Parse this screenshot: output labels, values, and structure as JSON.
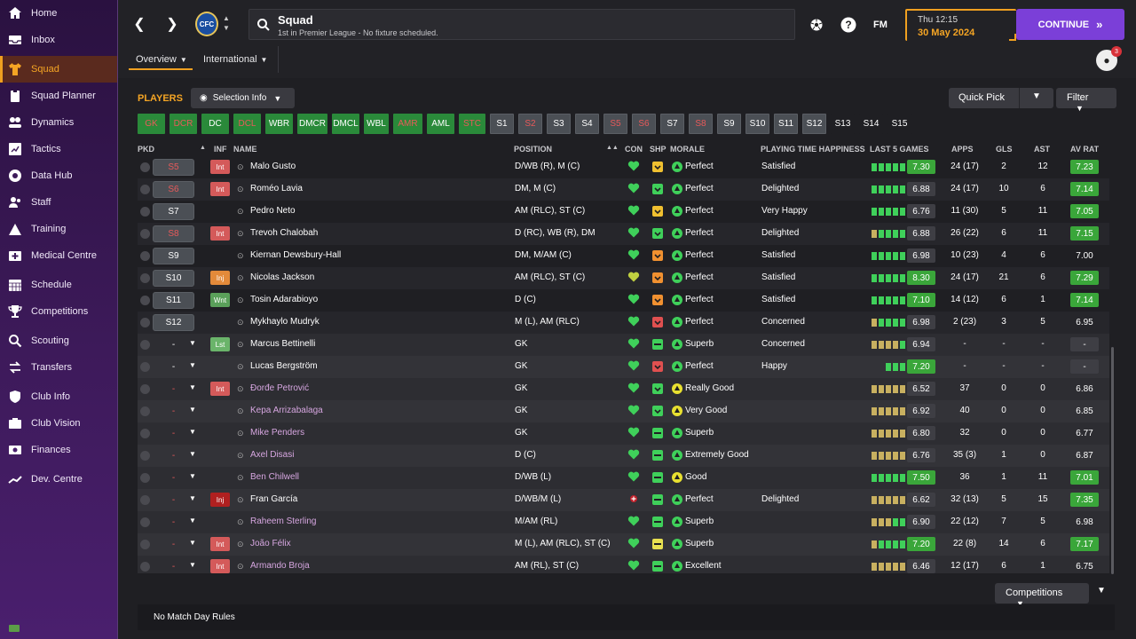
{
  "sidebar": {
    "items": [
      {
        "label": "Home",
        "icon": "home-icon"
      },
      {
        "label": "Inbox",
        "icon": "inbox-icon"
      },
      {
        "label": "Squad",
        "icon": "shirt-icon",
        "active": true
      },
      {
        "label": "Squad Planner",
        "icon": "clipboard-icon"
      },
      {
        "label": "Dynamics",
        "icon": "dynamics-icon"
      },
      {
        "label": "Tactics",
        "icon": "tactics-icon"
      },
      {
        "label": "Data Hub",
        "icon": "datahub-icon"
      },
      {
        "label": "Staff",
        "icon": "staff-icon"
      },
      {
        "label": "Training",
        "icon": "training-icon"
      },
      {
        "label": "Medical Centre",
        "icon": "medical-icon"
      },
      {
        "label": "Schedule",
        "icon": "calendar-icon"
      },
      {
        "label": "Competitions",
        "icon": "trophy-icon"
      },
      {
        "label": "Scouting",
        "icon": "search-icon"
      },
      {
        "label": "Transfers",
        "icon": "transfers-icon"
      },
      {
        "label": "Club Info",
        "icon": "shield-icon"
      },
      {
        "label": "Club Vision",
        "icon": "vision-icon"
      },
      {
        "label": "Finances",
        "icon": "finances-icon"
      },
      {
        "label": "Dev. Centre",
        "icon": "dev-centre-icon"
      }
    ]
  },
  "header": {
    "title": "Squad",
    "subtitle": "1st in Premier League - No fixture scheduled.",
    "fm_label": "FM",
    "date_day": "Thu 12:15",
    "date_date": "30 May 2024",
    "continue_label": "CONTINUE",
    "continue_icon": "»",
    "social_count": "3"
  },
  "tabs": {
    "overview": "Overview",
    "international": "International"
  },
  "panel": {
    "players_label": "PLAYERS",
    "selection_info": "Selection Info",
    "quick_pick": "Quick Pick",
    "filter": "Filter",
    "competitions": "Competitions",
    "match_day_rules": "No Match Day Rules"
  },
  "positions": [
    {
      "label": "GK",
      "style": "green-red",
      "w": 31
    },
    {
      "label": "DCR",
      "style": "green-red",
      "w": 31
    },
    {
      "label": "DC",
      "style": "green",
      "w": 31
    },
    {
      "label": "DCL",
      "style": "green-red",
      "w": 31
    },
    {
      "label": "WBR",
      "style": "green",
      "w": 31
    },
    {
      "label": "DMCR",
      "style": "green",
      "w": 34
    },
    {
      "label": "DMCL",
      "style": "green",
      "w": 31
    },
    {
      "label": "WBL",
      "style": "green",
      "w": 28
    },
    {
      "label": "AMR",
      "style": "green-red",
      "w": 33
    },
    {
      "label": "AML",
      "style": "green",
      "w": 31
    },
    {
      "label": "STC",
      "style": "green-red",
      "w": 30
    },
    {
      "label": "S1",
      "style": "grey",
      "w": 27
    },
    {
      "label": "S2",
      "style": "grey-red",
      "w": 27
    },
    {
      "label": "S3",
      "style": "grey",
      "w": 27
    },
    {
      "label": "S4",
      "style": "grey",
      "w": 27
    },
    {
      "label": "S5",
      "style": "grey-red",
      "w": 27
    },
    {
      "label": "S6",
      "style": "grey-red",
      "w": 27
    },
    {
      "label": "S7",
      "style": "grey",
      "w": 27
    },
    {
      "label": "S8",
      "style": "grey-red",
      "w": 27
    },
    {
      "label": "S9",
      "style": "grey",
      "w": 27
    },
    {
      "label": "S10",
      "style": "grey",
      "w": 27
    },
    {
      "label": "S11",
      "style": "grey",
      "w": 27
    },
    {
      "label": "S12",
      "style": "grey",
      "w": 27
    },
    {
      "label": "S13",
      "style": "dark",
      "w": 27
    },
    {
      "label": "S14",
      "style": "dark",
      "w": 27
    },
    {
      "label": "S15",
      "style": "dark",
      "w": 27
    }
  ],
  "columns": {
    "pkd": "PKD",
    "inf": "INF",
    "name": "NAME",
    "position": "POSITION",
    "con": "CON",
    "shp": "SHP",
    "morale": "MORALE",
    "pth": "PLAYING TIME HAPPINESS",
    "last5": "LAST 5 GAMES",
    "apps": "APPS",
    "gls": "GLS",
    "ast": "AST",
    "avrat": "AV RAT"
  },
  "colors": {
    "accent": "#f5a524",
    "continue": "#7b3fd8",
    "green": "#3aa63a",
    "red": "#d45a5a"
  },
  "players": [
    {
      "pkd": "S5",
      "pkd_style": "sq red",
      "inf": "Int",
      "name": "Malo Gusto",
      "pos": "D/WB (R), M (C)",
      "con": "full",
      "shp": "yellow",
      "mor_ico": "green",
      "morale": "Perfect",
      "pth": "Satisfied",
      "bars": [
        "g",
        "g",
        "g",
        "g",
        "g"
      ],
      "l5": "7.30",
      "l5_style": "rating-green",
      "apps": "24 (17)",
      "gls": "2",
      "ast": "12",
      "avr": "7.23",
      "avr_style": "rating-green",
      "lower": false
    },
    {
      "pkd": "S6",
      "pkd_style": "sq red",
      "inf": "Int",
      "name": "Roméo Lavia",
      "pos": "DM, M (C)",
      "con": "full",
      "shp": "green",
      "mor_ico": "green",
      "morale": "Perfect",
      "pth": "Delighted",
      "bars": [
        "g",
        "g",
        "g",
        "g",
        "g"
      ],
      "l5": "6.88",
      "l5_style": "rating-grey",
      "apps": "24 (17)",
      "gls": "10",
      "ast": "6",
      "avr": "7.14",
      "avr_style": "rating-green",
      "lower": false
    },
    {
      "pkd": "S7",
      "pkd_style": "sq",
      "inf": "",
      "name": "Pedro Neto",
      "pos": "AM (RLC), ST (C)",
      "con": "full",
      "shp": "yellow",
      "mor_ico": "green",
      "morale": "Perfect",
      "pth": "Very Happy",
      "bars": [
        "g",
        "g",
        "g",
        "g",
        "g"
      ],
      "l5": "6.76",
      "l5_style": "rating-grey",
      "apps": "11 (30)",
      "gls": "5",
      "ast": "11",
      "avr": "7.05",
      "avr_style": "rating-green",
      "lower": false
    },
    {
      "pkd": "S8",
      "pkd_style": "sq red",
      "inf": "Int",
      "name": "Trevoh Chalobah",
      "pos": "D (RC), WB (R), DM",
      "con": "full",
      "shp": "green",
      "mor_ico": "green",
      "morale": "Perfect",
      "pth": "Delighted",
      "bars": [
        "o",
        "g",
        "g",
        "g",
        "g"
      ],
      "l5": "6.88",
      "l5_style": "rating-grey",
      "apps": "26 (22)",
      "gls": "6",
      "ast": "11",
      "avr": "7.15",
      "avr_style": "rating-green",
      "lower": false
    },
    {
      "pkd": "S9",
      "pkd_style": "sq",
      "inf": "",
      "name": "Kiernan Dewsbury-Hall",
      "pos": "DM, M/AM (C)",
      "con": "full",
      "shp": "orange",
      "mor_ico": "green",
      "morale": "Perfect",
      "pth": "Satisfied",
      "bars": [
        "g",
        "g",
        "g",
        "g",
        "g"
      ],
      "l5": "6.98",
      "l5_style": "rating-grey",
      "apps": "10 (23)",
      "gls": "4",
      "ast": "6",
      "avr": "7.00",
      "avr_style": "rating-plain",
      "lower": false
    },
    {
      "pkd": "S10",
      "pkd_style": "sq",
      "inf": "Inj",
      "name": "Nicolas Jackson",
      "pos": "AM (RLC), ST (C)",
      "con": "half",
      "shp": "orange",
      "mor_ico": "green",
      "morale": "Perfect",
      "pth": "Satisfied",
      "bars": [
        "g",
        "g",
        "g",
        "g",
        "g"
      ],
      "l5": "8.30",
      "l5_style": "rating-green",
      "apps": "24 (17)",
      "gls": "21",
      "ast": "6",
      "avr": "7.29",
      "avr_style": "rating-green",
      "lower": false
    },
    {
      "pkd": "S11",
      "pkd_style": "sq",
      "inf": "Wnt",
      "name": "Tosin Adarabioyo",
      "pos": "D (C)",
      "con": "full",
      "shp": "orange",
      "mor_ico": "green",
      "morale": "Perfect",
      "pth": "Satisfied",
      "bars": [
        "g",
        "g",
        "g",
        "g",
        "g"
      ],
      "l5": "7.10",
      "l5_style": "rating-green",
      "apps": "14 (12)",
      "gls": "6",
      "ast": "1",
      "avr": "7.14",
      "avr_style": "rating-green",
      "lower": false
    },
    {
      "pkd": "S12",
      "pkd_style": "sq",
      "inf": "",
      "name": "Mykhaylo Mudryk",
      "pos": "M (L), AM (RLC)",
      "con": "full",
      "shp": "red",
      "mor_ico": "green",
      "morale": "Perfect",
      "pth": "Concerned",
      "bars": [
        "o",
        "g",
        "g",
        "g",
        "g"
      ],
      "l5": "6.98",
      "l5_style": "rating-grey",
      "apps": "2 (23)",
      "gls": "3",
      "ast": "5",
      "avr": "6.95",
      "avr_style": "rating-plain",
      "lower": false
    },
    {
      "pkd": "-",
      "pkd_style": "dash",
      "inf": "Lst",
      "name": "Marcus Bettinelli",
      "pos": "GK",
      "con": "full",
      "shp": "greenbar",
      "mor_ico": "green",
      "morale": "Superb",
      "pth": "Concerned",
      "bars": [
        "o",
        "o",
        "o",
        "o",
        "g"
      ],
      "l5": "6.94",
      "l5_style": "rating-grey",
      "apps": "-",
      "gls": "-",
      "ast": "-",
      "avr": "-",
      "avr_style": "rating-grey",
      "lower": true
    },
    {
      "pkd": "-",
      "pkd_style": "dash",
      "inf": "",
      "name": "Lucas Bergström",
      "pos": "GK",
      "con": "full",
      "shp": "red",
      "mor_ico": "green",
      "morale": "Perfect",
      "pth": "Happy",
      "bars": [
        "",
        "",
        "g",
        "g",
        "g"
      ],
      "l5": "7.20",
      "l5_style": "rating-green",
      "apps": "-",
      "gls": "-",
      "ast": "-",
      "avr": "-",
      "avr_style": "rating-grey",
      "lower": true
    },
    {
      "pkd": "-",
      "pkd_style": "dash red",
      "inf": "Int",
      "name": "Đorđe Petrović",
      "pos": "GK",
      "con": "full",
      "shp": "green",
      "mor_ico": "yellow",
      "morale": "Really Good",
      "pth": "",
      "bars": [
        "o",
        "o",
        "o",
        "o",
        "o"
      ],
      "l5": "6.52",
      "l5_style": "rating-grey",
      "apps": "37",
      "gls": "0",
      "ast": "0",
      "avr": "6.86",
      "avr_style": "rating-plain",
      "lower": true,
      "loan": true
    },
    {
      "pkd": "-",
      "pkd_style": "dash red",
      "inf": "",
      "name": "Kepa Arrizabalaga",
      "pos": "GK",
      "con": "full",
      "shp": "green",
      "mor_ico": "yellow",
      "morale": "Very Good",
      "pth": "",
      "bars": [
        "o",
        "o",
        "o",
        "o",
        "o"
      ],
      "l5": "6.92",
      "l5_style": "rating-grey",
      "apps": "40",
      "gls": "0",
      "ast": "0",
      "avr": "6.85",
      "avr_style": "rating-plain",
      "lower": true,
      "loan": true
    },
    {
      "pkd": "-",
      "pkd_style": "dash red",
      "inf": "",
      "name": "Mike Penders",
      "pos": "GK",
      "con": "full",
      "shp": "greenbar",
      "mor_ico": "green",
      "morale": "Superb",
      "pth": "",
      "bars": [
        "o",
        "o",
        "o",
        "o",
        "o"
      ],
      "l5": "6.80",
      "l5_style": "rating-grey",
      "apps": "32",
      "gls": "0",
      "ast": "0",
      "avr": "6.77",
      "avr_style": "rating-plain",
      "lower": true,
      "loan": true
    },
    {
      "pkd": "-",
      "pkd_style": "dash red",
      "inf": "",
      "name": "Axel Disasi",
      "pos": "D (C)",
      "con": "full",
      "shp": "greenbar",
      "mor_ico": "green",
      "morale": "Extremely Good",
      "pth": "",
      "bars": [
        "o",
        "o",
        "o",
        "o",
        "o"
      ],
      "l5": "6.76",
      "l5_style": "rating-grey",
      "apps": "35 (3)",
      "gls": "1",
      "ast": "0",
      "avr": "6.87",
      "avr_style": "rating-plain",
      "lower": true,
      "loan": true
    },
    {
      "pkd": "-",
      "pkd_style": "dash red",
      "inf": "",
      "name": "Ben Chilwell",
      "pos": "D/WB (L)",
      "con": "full",
      "shp": "greenbar",
      "mor_ico": "yellow",
      "morale": "Good",
      "pth": "",
      "bars": [
        "g",
        "g",
        "g",
        "g",
        "g"
      ],
      "l5": "7.50",
      "l5_style": "rating-green",
      "apps": "36",
      "gls": "1",
      "ast": "11",
      "avr": "7.01",
      "avr_style": "rating-green",
      "lower": true,
      "loan": true
    },
    {
      "pkd": "-",
      "pkd_style": "dash red",
      "inf": "Inj",
      "inf_style": "injdark",
      "name": "Fran García",
      "pos": "D/WB/M (L)",
      "con": "injury",
      "shp": "greenbar",
      "mor_ico": "green",
      "morale": "Perfect",
      "pth": "Delighted",
      "bars": [
        "o",
        "o",
        "o",
        "o",
        "o"
      ],
      "l5": "6.62",
      "l5_style": "rating-grey",
      "apps": "32 (13)",
      "gls": "5",
      "ast": "15",
      "avr": "7.35",
      "avr_style": "rating-green",
      "lower": true
    },
    {
      "pkd": "-",
      "pkd_style": "dash red",
      "inf": "",
      "name": "Raheem Sterling",
      "pos": "M/AM (RL)",
      "con": "full",
      "shp": "greenbar",
      "mor_ico": "green",
      "morale": "Superb",
      "pth": "",
      "bars": [
        "o",
        "o",
        "o",
        "g",
        "g"
      ],
      "l5": "6.90",
      "l5_style": "rating-grey",
      "apps": "22 (12)",
      "gls": "7",
      "ast": "5",
      "avr": "6.98",
      "avr_style": "rating-plain",
      "lower": true,
      "loan": true
    },
    {
      "pkd": "-",
      "pkd_style": "dash red",
      "inf": "Int",
      "name": "João Félix",
      "pos": "M (L), AM (RLC), ST (C)",
      "con": "full",
      "shp": "yellowbar",
      "mor_ico": "green",
      "morale": "Superb",
      "pth": "",
      "bars": [
        "o",
        "g",
        "g",
        "g",
        "g"
      ],
      "l5": "7.20",
      "l5_style": "rating-green",
      "apps": "22 (8)",
      "gls": "14",
      "ast": "6",
      "avr": "7.17",
      "avr_style": "rating-green",
      "lower": true,
      "loan": true
    },
    {
      "pkd": "-",
      "pkd_style": "dash red",
      "inf": "Int",
      "name": "Armando Broja",
      "pos": "AM (RL), ST (C)",
      "con": "full",
      "shp": "greenbar",
      "mor_ico": "green",
      "morale": "Excellent",
      "pth": "",
      "bars": [
        "o",
        "o",
        "o",
        "o",
        "o"
      ],
      "l5": "6.46",
      "l5_style": "rating-grey",
      "apps": "12 (17)",
      "gls": "6",
      "ast": "1",
      "avr": "6.75",
      "avr_style": "rating-plain",
      "lower": true,
      "loan": true
    }
  ]
}
